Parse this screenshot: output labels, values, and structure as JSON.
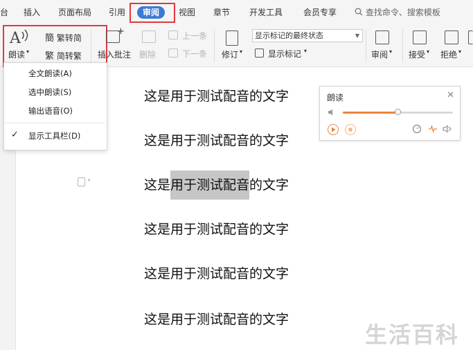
{
  "menubar": {
    "tabs": [
      {
        "label": "台"
      },
      {
        "label": "插入"
      },
      {
        "label": "页面布局"
      },
      {
        "label": "引用"
      },
      {
        "label": "审阅"
      },
      {
        "label": "视图"
      },
      {
        "label": "章节"
      },
      {
        "label": "开发工具"
      },
      {
        "label": "会员专享"
      }
    ],
    "active_tab": "审阅",
    "search_label": "查找命令、搜索模板"
  },
  "ribbon": {
    "read_aloud": "朗读",
    "trad_to_simp": "繁转简",
    "simp_to_trad": "简转繁",
    "insert_comment": "插入批注",
    "delete": "删除",
    "prev": "上一条",
    "next": "下一条",
    "revise": "修订",
    "markup_state": "显示标记的最终状态",
    "show_markup": "显示标记",
    "review": "审阅",
    "accept": "接受",
    "reject": "拒绝"
  },
  "read_menu": {
    "items": [
      "全文朗读(A)",
      "选中朗读(S)",
      "输出语音(O)"
    ],
    "toolbar_toggle": "显示工具栏(D)",
    "toolbar_checked": true
  },
  "read_panel": {
    "title": "朗读",
    "volume": 0.5
  },
  "document": {
    "lines": [
      "这是用于测试配音的文字",
      "这是用于测试配音的文字",
      "这是用于测试配音的文字",
      "这是用于测试配音的文字",
      "这是用于测试配音的文字",
      "这是用于测试配音的文字"
    ],
    "highlight_line": 2,
    "highlight_pre": "这是",
    "highlight_text": "用于测试配音",
    "highlight_post": "的文字"
  },
  "watermark": "生活百科",
  "colors": {
    "accent": "#3a7bd5",
    "annotation_red": "#e0393e",
    "slider_orange": "#e8853b",
    "highlight_gray": "#c6c6c6"
  }
}
